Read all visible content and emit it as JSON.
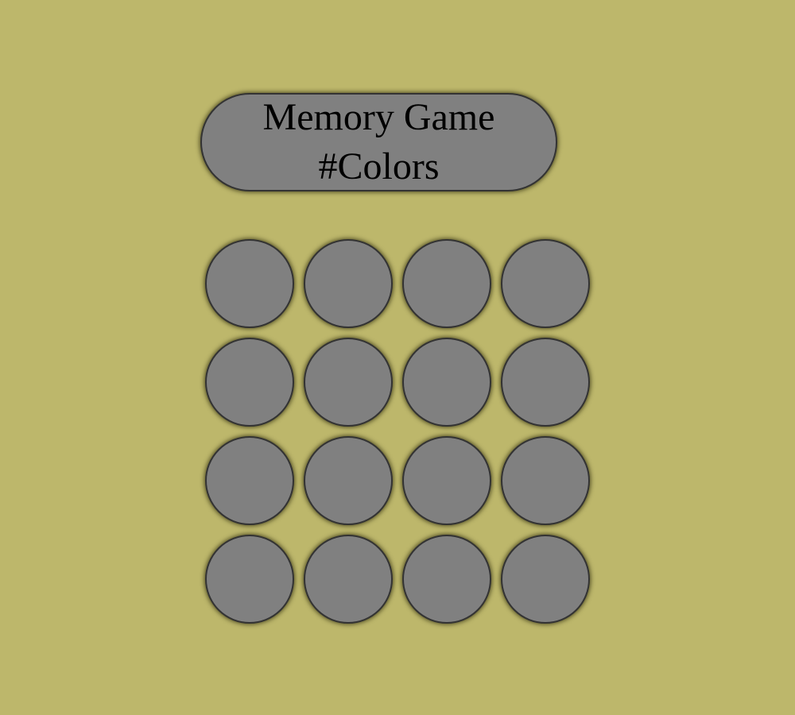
{
  "title": {
    "line1": "Memory Game",
    "line2": "#Colors"
  },
  "colors": {
    "background": "#bdb76b",
    "tile_face_down": "#808080",
    "border": "#333333"
  },
  "board": {
    "rows": 4,
    "columns": 4,
    "tiles": [
      {
        "state": "face-down"
      },
      {
        "state": "face-down"
      },
      {
        "state": "face-down"
      },
      {
        "state": "face-down"
      },
      {
        "state": "face-down"
      },
      {
        "state": "face-down"
      },
      {
        "state": "face-down"
      },
      {
        "state": "face-down"
      },
      {
        "state": "face-down"
      },
      {
        "state": "face-down"
      },
      {
        "state": "face-down"
      },
      {
        "state": "face-down"
      },
      {
        "state": "face-down"
      },
      {
        "state": "face-down"
      },
      {
        "state": "face-down"
      },
      {
        "state": "face-down"
      }
    ]
  }
}
